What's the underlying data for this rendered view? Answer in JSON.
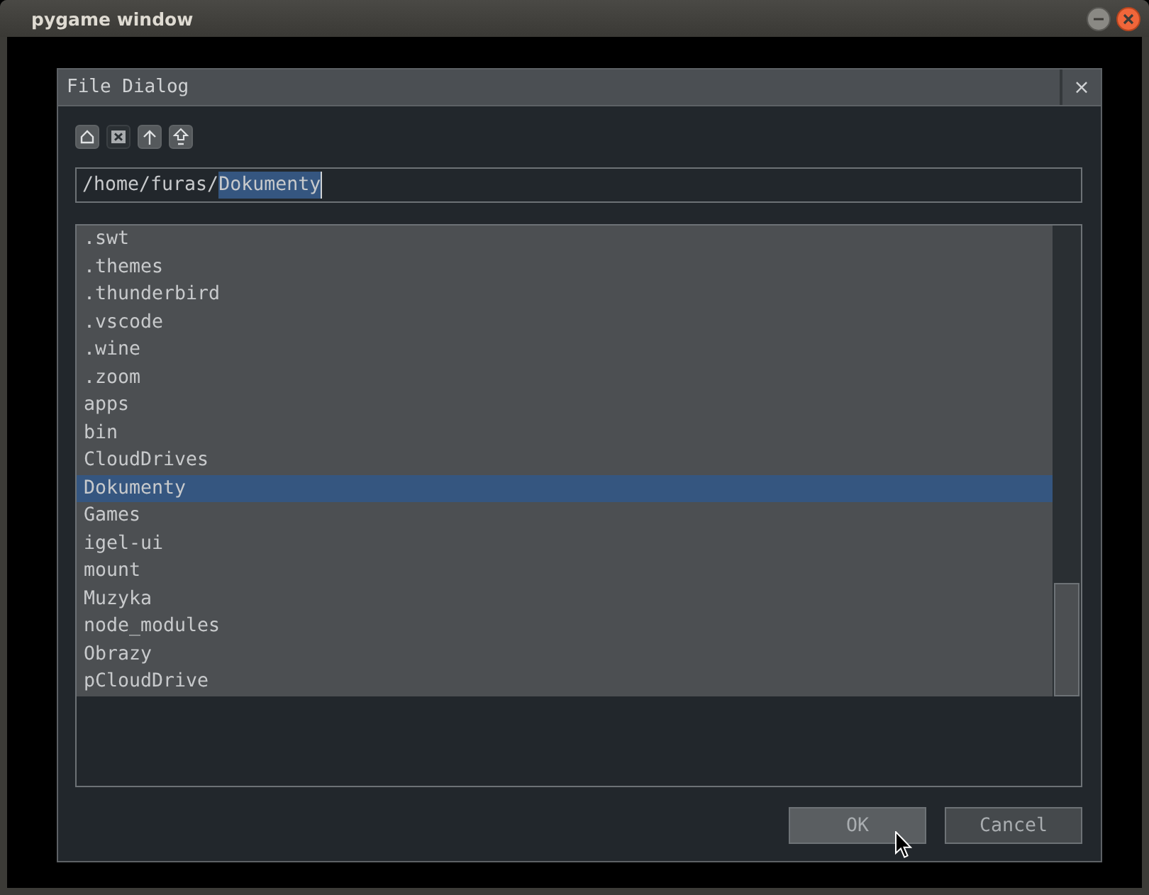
{
  "window": {
    "title": "pygame window"
  },
  "dialog": {
    "title": "File Dialog",
    "close": "×"
  },
  "toolbar": [
    {
      "kind": "home",
      "selected": false
    },
    {
      "kind": "hidden",
      "selected": true
    },
    {
      "kind": "up",
      "selected": false
    },
    {
      "kind": "root",
      "selected": false
    }
  ],
  "path_field": {
    "text": "/home/furas/",
    "selected_text": "Dokumenty"
  },
  "files": [
    {
      "name": ".swt",
      "selected": false
    },
    {
      "name": ".themes",
      "selected": false
    },
    {
      "name": ".thunderbird",
      "selected": false
    },
    {
      "name": ".vscode",
      "selected": false
    },
    {
      "name": ".wine",
      "selected": false
    },
    {
      "name": ".zoom",
      "selected": false
    },
    {
      "name": "apps",
      "selected": false
    },
    {
      "name": "bin",
      "selected": false
    },
    {
      "name": "CloudDrives",
      "selected": false
    },
    {
      "name": "Dokumenty",
      "selected": true
    },
    {
      "name": "Games",
      "selected": false
    },
    {
      "name": "igel-ui",
      "selected": false
    },
    {
      "name": "mount",
      "selected": false
    },
    {
      "name": "Muzyka",
      "selected": false
    },
    {
      "name": "node_modules",
      "selected": false
    },
    {
      "name": "Obrazy",
      "selected": false
    },
    {
      "name": "pCloudDrive",
      "selected": false
    }
  ],
  "buttons": [
    {
      "label": "OK",
      "hovered": true
    },
    {
      "label": "Cancel",
      "hovered": false
    }
  ]
}
